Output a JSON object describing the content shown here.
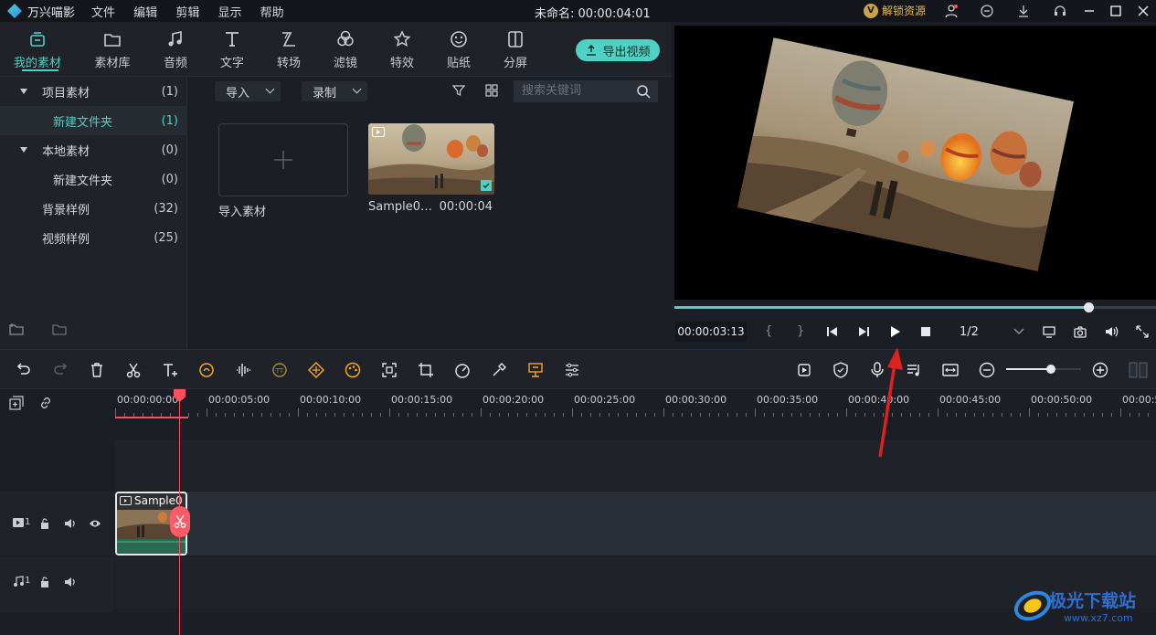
{
  "app": {
    "name": "万兴喵影"
  },
  "menu": [
    "文件",
    "编辑",
    "剪辑",
    "显示",
    "帮助"
  ],
  "document": {
    "title": "未命名: 00:00:04:01"
  },
  "unlock": {
    "badge": "V",
    "label": "解锁资源"
  },
  "media_tabs": [
    {
      "label": "我的素材",
      "icon": "my-media-icon",
      "active": true
    },
    {
      "label": "素材库",
      "icon": "folder-icon"
    },
    {
      "label": "音频",
      "icon": "music-note-icon"
    },
    {
      "label": "文字",
      "icon": "text-icon"
    },
    {
      "label": "转场",
      "icon": "transition-icon"
    },
    {
      "label": "滤镜",
      "icon": "filter-icon"
    },
    {
      "label": "特效",
      "icon": "effects-icon"
    },
    {
      "label": "贴纸",
      "icon": "sticker-icon"
    },
    {
      "label": "分屏",
      "icon": "split-screen-icon"
    }
  ],
  "export_button": {
    "label": "导出视频"
  },
  "tree": [
    {
      "name": "项目素材",
      "count": "(1)",
      "expanded": true
    },
    {
      "name": "新建文件夹",
      "count": "(1)",
      "selected": true
    },
    {
      "name": "本地素材",
      "count": "(0)",
      "expanded": true
    },
    {
      "name": "新建文件夹",
      "count": "(0)"
    },
    {
      "name": "背景样例",
      "count": "(32)"
    },
    {
      "name": "视频样例",
      "count": "(25)"
    }
  ],
  "media_toolbar": {
    "import": "导入",
    "record": "录制",
    "search_placeholder": "搜索关键词"
  },
  "media_items": [
    {
      "name": "导入素材",
      "duration": ""
    },
    {
      "name": "Sample0…",
      "duration": "00:00:04"
    }
  ],
  "preview": {
    "time": "00:00:03:13",
    "ratio": "1/2",
    "progress": 0.86,
    "bracket_in": "{",
    "bracket_out": "}"
  },
  "zoom": {
    "level": 0.6
  },
  "ruler": [
    "00:00:00:00",
    "00:00:05:00",
    "00:00:10:00",
    "00:00:15:00",
    "00:00:20:00",
    "00:00:25:00",
    "00:00:30:00",
    "00:00:35:00",
    "00:00:40:00",
    "00:00:45:00",
    "00:00:50:00",
    "00:00:5"
  ],
  "tracks": {
    "video_label": "1",
    "audio_label": "1",
    "clip_name": "Sample0"
  },
  "watermark": {
    "line1": "极光下载站",
    "line2": "www.xz7.com"
  },
  "colors": {
    "accent": "#4fd1c5",
    "playhead": "#ff4d5e",
    "annotation": "#e02020"
  }
}
